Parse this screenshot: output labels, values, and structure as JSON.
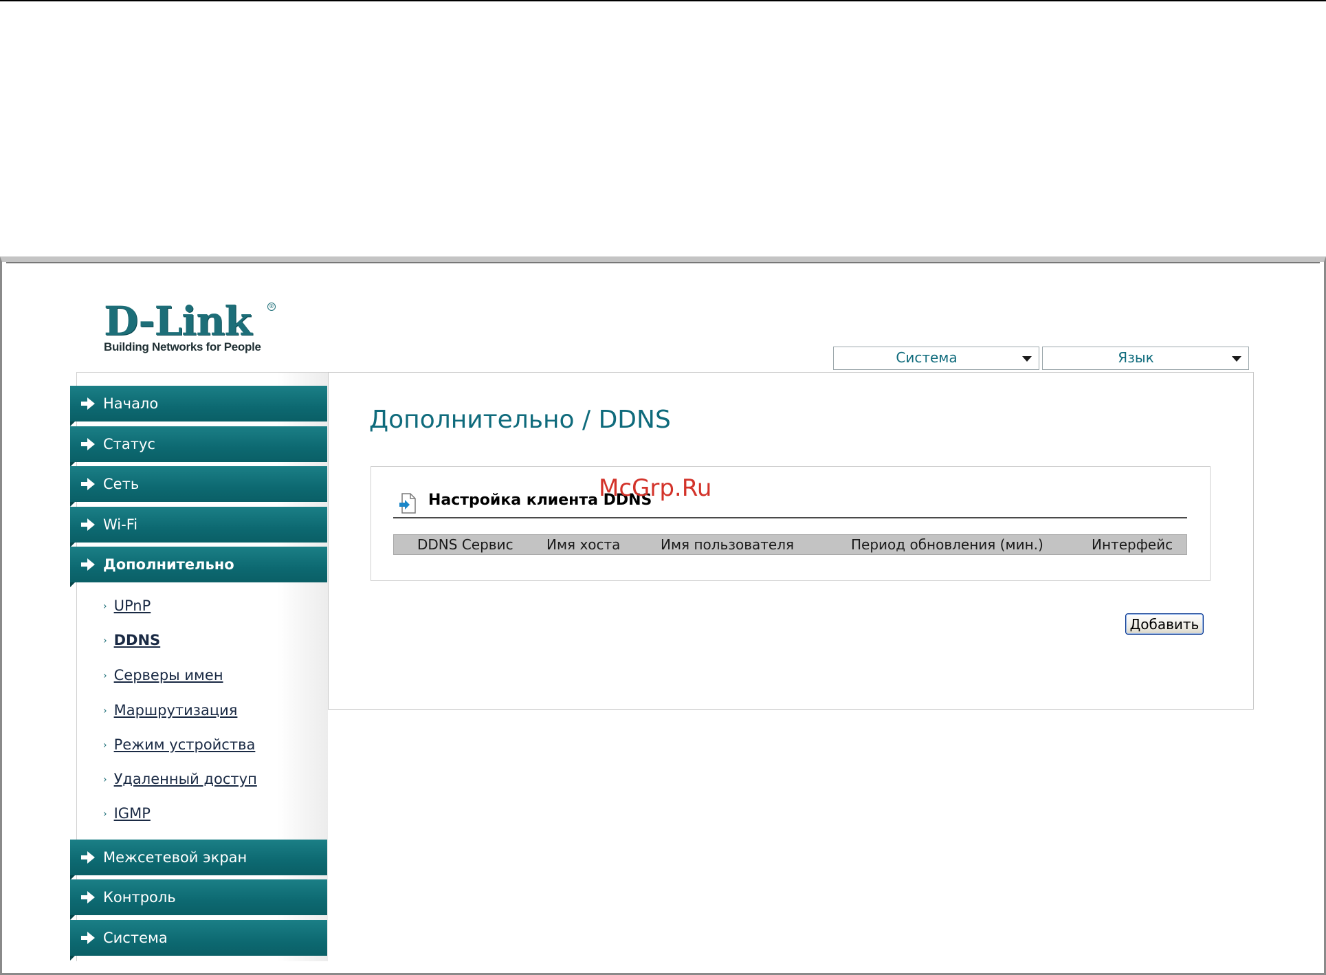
{
  "logo": {
    "brand": "D-Link",
    "tagline": "Building Networks for People",
    "trademark": "®"
  },
  "top_selects": {
    "system": "Система",
    "language": "Язык"
  },
  "nav": {
    "home": "Начало",
    "status": "Статус",
    "network": "Сеть",
    "wifi": "Wi-Fi",
    "advanced": "Дополнительно",
    "firewall": "Межсетевой экран",
    "control": "Контроль",
    "system": "Система"
  },
  "subnav": {
    "upnp": "UPnP",
    "ddns": "DDNS",
    "dns_servers": "Серверы имен",
    "routing": "Маршрутизация",
    "device_mode": "Режим устройства",
    "remote_access": "Удаленный доступ",
    "igmp": "IGMP"
  },
  "main": {
    "page_title": "Дополнительно /  DDNS",
    "section_title": "Настройка клиента DDNS",
    "table": {
      "columns": [
        "DDNS Сервис",
        "Имя хоста",
        "Имя пользователя",
        "Период обновления (мин.)",
        "Интерфейс"
      ]
    },
    "add_label": "Добавить"
  },
  "watermark": "McGrp.Ru",
  "colors": {
    "accent": "#0f6b7c",
    "nav_bg": "#0d6971",
    "watermark": "#d3332a"
  }
}
